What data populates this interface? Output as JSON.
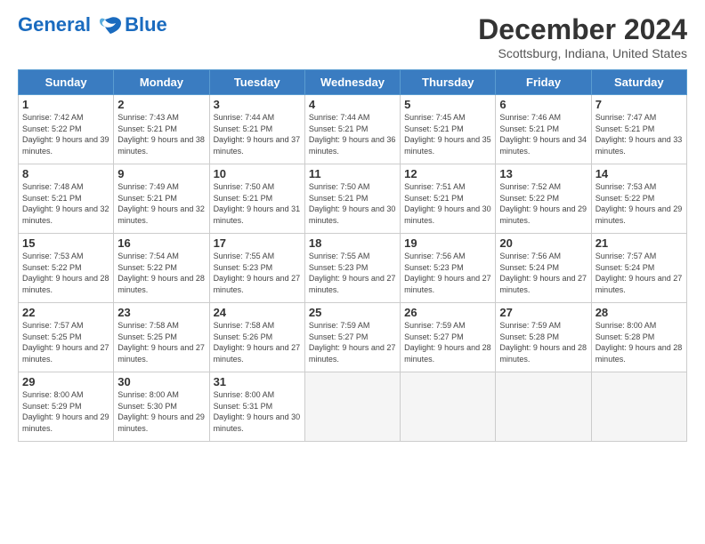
{
  "header": {
    "logo_line1": "General",
    "logo_line2": "Blue",
    "month": "December 2024",
    "location": "Scottsburg, Indiana, United States"
  },
  "weekdays": [
    "Sunday",
    "Monday",
    "Tuesday",
    "Wednesday",
    "Thursday",
    "Friday",
    "Saturday"
  ],
  "weeks": [
    [
      {
        "day": "1",
        "sunrise": "7:42 AM",
        "sunset": "5:22 PM",
        "daylight": "9 hours and 39 minutes."
      },
      {
        "day": "2",
        "sunrise": "7:43 AM",
        "sunset": "5:21 PM",
        "daylight": "9 hours and 38 minutes."
      },
      {
        "day": "3",
        "sunrise": "7:44 AM",
        "sunset": "5:21 PM",
        "daylight": "9 hours and 37 minutes."
      },
      {
        "day": "4",
        "sunrise": "7:44 AM",
        "sunset": "5:21 PM",
        "daylight": "9 hours and 36 minutes."
      },
      {
        "day": "5",
        "sunrise": "7:45 AM",
        "sunset": "5:21 PM",
        "daylight": "9 hours and 35 minutes."
      },
      {
        "day": "6",
        "sunrise": "7:46 AM",
        "sunset": "5:21 PM",
        "daylight": "9 hours and 34 minutes."
      },
      {
        "day": "7",
        "sunrise": "7:47 AM",
        "sunset": "5:21 PM",
        "daylight": "9 hours and 33 minutes."
      }
    ],
    [
      {
        "day": "8",
        "sunrise": "7:48 AM",
        "sunset": "5:21 PM",
        "daylight": "9 hours and 32 minutes."
      },
      {
        "day": "9",
        "sunrise": "7:49 AM",
        "sunset": "5:21 PM",
        "daylight": "9 hours and 32 minutes."
      },
      {
        "day": "10",
        "sunrise": "7:50 AM",
        "sunset": "5:21 PM",
        "daylight": "9 hours and 31 minutes."
      },
      {
        "day": "11",
        "sunrise": "7:50 AM",
        "sunset": "5:21 PM",
        "daylight": "9 hours and 30 minutes."
      },
      {
        "day": "12",
        "sunrise": "7:51 AM",
        "sunset": "5:21 PM",
        "daylight": "9 hours and 30 minutes."
      },
      {
        "day": "13",
        "sunrise": "7:52 AM",
        "sunset": "5:22 PM",
        "daylight": "9 hours and 29 minutes."
      },
      {
        "day": "14",
        "sunrise": "7:53 AM",
        "sunset": "5:22 PM",
        "daylight": "9 hours and 29 minutes."
      }
    ],
    [
      {
        "day": "15",
        "sunrise": "7:53 AM",
        "sunset": "5:22 PM",
        "daylight": "9 hours and 28 minutes."
      },
      {
        "day": "16",
        "sunrise": "7:54 AM",
        "sunset": "5:22 PM",
        "daylight": "9 hours and 28 minutes."
      },
      {
        "day": "17",
        "sunrise": "7:55 AM",
        "sunset": "5:23 PM",
        "daylight": "9 hours and 27 minutes."
      },
      {
        "day": "18",
        "sunrise": "7:55 AM",
        "sunset": "5:23 PM",
        "daylight": "9 hours and 27 minutes."
      },
      {
        "day": "19",
        "sunrise": "7:56 AM",
        "sunset": "5:23 PM",
        "daylight": "9 hours and 27 minutes."
      },
      {
        "day": "20",
        "sunrise": "7:56 AM",
        "sunset": "5:24 PM",
        "daylight": "9 hours and 27 minutes."
      },
      {
        "day": "21",
        "sunrise": "7:57 AM",
        "sunset": "5:24 PM",
        "daylight": "9 hours and 27 minutes."
      }
    ],
    [
      {
        "day": "22",
        "sunrise": "7:57 AM",
        "sunset": "5:25 PM",
        "daylight": "9 hours and 27 minutes."
      },
      {
        "day": "23",
        "sunrise": "7:58 AM",
        "sunset": "5:25 PM",
        "daylight": "9 hours and 27 minutes."
      },
      {
        "day": "24",
        "sunrise": "7:58 AM",
        "sunset": "5:26 PM",
        "daylight": "9 hours and 27 minutes."
      },
      {
        "day": "25",
        "sunrise": "7:59 AM",
        "sunset": "5:27 PM",
        "daylight": "9 hours and 27 minutes."
      },
      {
        "day": "26",
        "sunrise": "7:59 AM",
        "sunset": "5:27 PM",
        "daylight": "9 hours and 28 minutes."
      },
      {
        "day": "27",
        "sunrise": "7:59 AM",
        "sunset": "5:28 PM",
        "daylight": "9 hours and 28 minutes."
      },
      {
        "day": "28",
        "sunrise": "8:00 AM",
        "sunset": "5:28 PM",
        "daylight": "9 hours and 28 minutes."
      }
    ],
    [
      {
        "day": "29",
        "sunrise": "8:00 AM",
        "sunset": "5:29 PM",
        "daylight": "9 hours and 29 minutes."
      },
      {
        "day": "30",
        "sunrise": "8:00 AM",
        "sunset": "5:30 PM",
        "daylight": "9 hours and 29 minutes."
      },
      {
        "day": "31",
        "sunrise": "8:00 AM",
        "sunset": "5:31 PM",
        "daylight": "9 hours and 30 minutes."
      },
      null,
      null,
      null,
      null
    ]
  ]
}
